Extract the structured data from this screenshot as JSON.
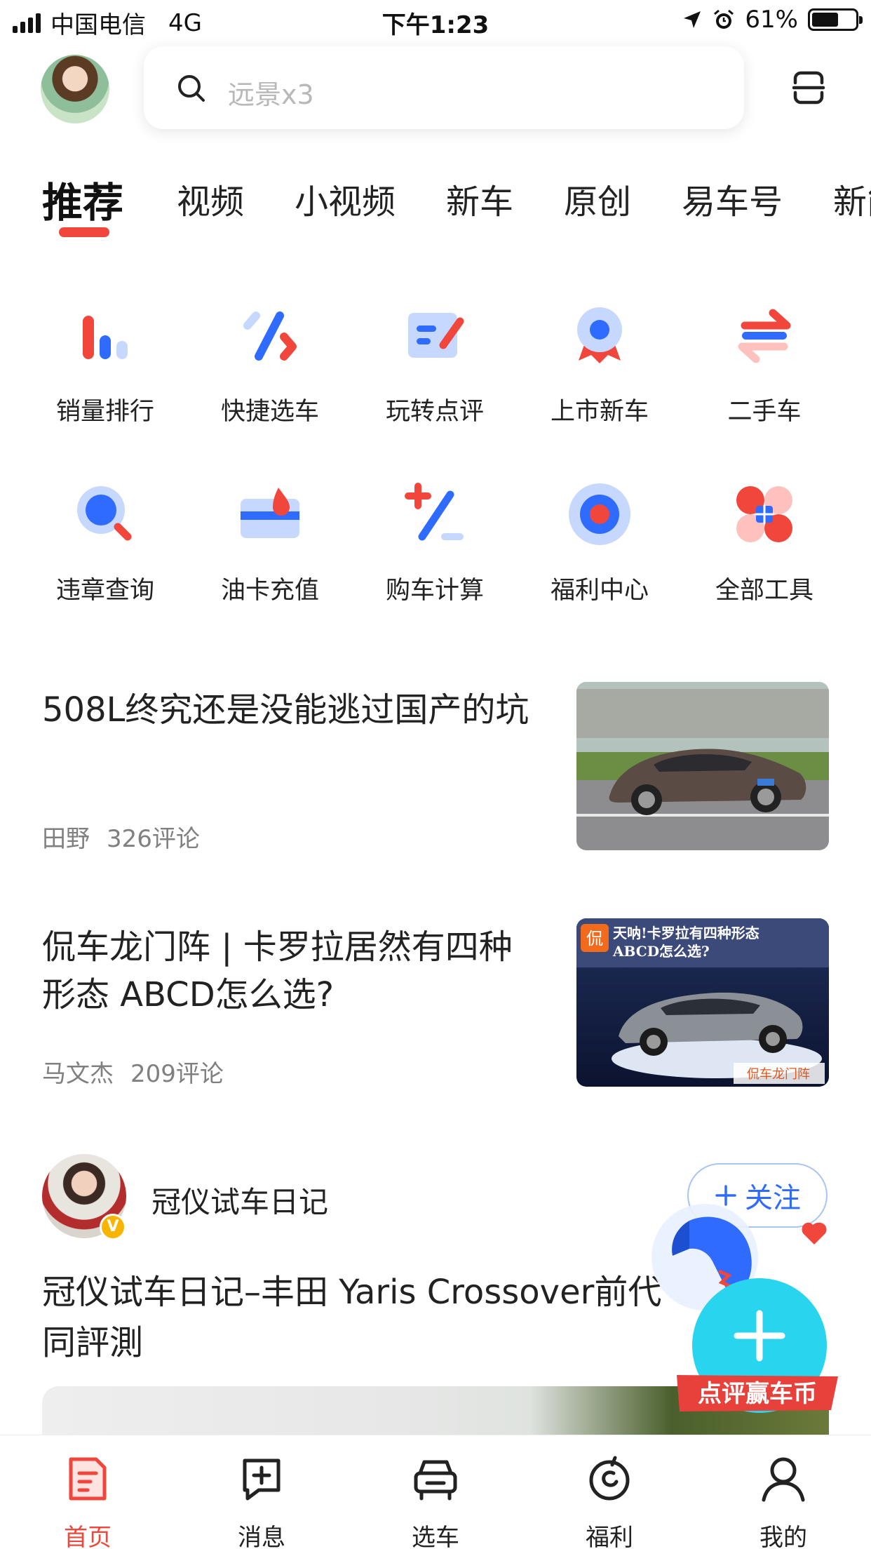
{
  "status_bar": {
    "carrier": "中国电信",
    "network": "4G",
    "time": "下午1:23",
    "battery_percent": "61%",
    "battery_level": 0.61
  },
  "header": {
    "search_placeholder": "远景x3"
  },
  "tabs": [
    "推荐",
    "视频",
    "小视频",
    "新车",
    "原创",
    "易车号",
    "新能"
  ],
  "tools": [
    {
      "label": "销量排行",
      "icon": "sales-rank-icon"
    },
    {
      "label": "快捷选车",
      "icon": "quick-pick-icon"
    },
    {
      "label": "玩转点评",
      "icon": "review-icon"
    },
    {
      "label": "上市新车",
      "icon": "new-car-badge-icon"
    },
    {
      "label": "二手车",
      "icon": "used-car-arrows-icon"
    },
    {
      "label": "违章查询",
      "icon": "violation-search-icon"
    },
    {
      "label": "油卡充值",
      "icon": "fuel-card-icon"
    },
    {
      "label": "购车计算",
      "icon": "calculator-icon"
    },
    {
      "label": "福利中心",
      "icon": "benefit-center-icon"
    },
    {
      "label": "全部工具",
      "icon": "all-tools-icon"
    }
  ],
  "articles": [
    {
      "title_lines": [
        "508L终究还是没能逃过国产的坑"
      ],
      "author": "田野",
      "comments": "326评论"
    },
    {
      "title_lines": [
        "侃车龙门阵 | 卡罗拉居然有四种",
        "形态  ABCD怎么选?"
      ],
      "author": "马文杰",
      "comments": "209评论",
      "thumb_text": [
        "侃",
        "天呐!卡罗拉有四种形态",
        "ABCD怎么选?",
        "侃车龙门阵"
      ]
    }
  ],
  "post": {
    "author": "冠仪试车日记",
    "follow_label": "关注",
    "badge": "V",
    "title_lines": [
      "冠仪试车日记–丰田 Yaris Crossover前代",
      "同評測"
    ]
  },
  "floating_widget": {
    "label": "点评赢车币"
  },
  "bottom_nav": [
    {
      "label": "首页",
      "icon": "home-icon",
      "active": true
    },
    {
      "label": "消息",
      "icon": "message-icon",
      "active": false
    },
    {
      "label": "选车",
      "icon": "car-select-icon",
      "active": false
    },
    {
      "label": "福利",
      "icon": "benefit-icon",
      "active": false
    },
    {
      "label": "我的",
      "icon": "profile-icon",
      "active": false
    }
  ],
  "colors": {
    "accent_red": "#f0463c",
    "accent_blue": "#2f6bff",
    "light_blue": "#c7d8ff"
  }
}
